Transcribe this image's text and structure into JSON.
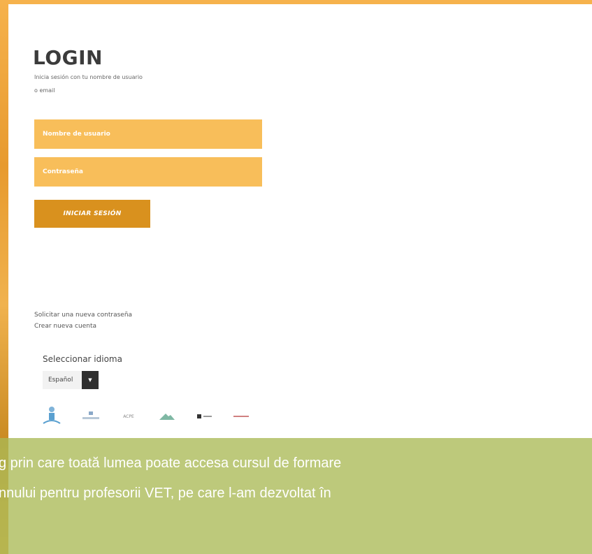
{
  "login": {
    "title": "LOGIN",
    "subtitle": "Inicia sesión con tu nombre de usuario o email",
    "username_placeholder": "Nombre de usuario",
    "password_placeholder": "Contraseña",
    "submit_label": "INICIAR SESIÓN"
  },
  "links": {
    "reset_password": "Solicitar una nueva contraseña",
    "create_account": "Crear nueva cuenta"
  },
  "language": {
    "label": "Seleccionar idioma",
    "selected": "Español"
  },
  "partners": {
    "logo3_text": "ACPE"
  },
  "caption": {
    "line1": "g prin care toată lumea poate accesa cursul de formare",
    "line2": "nnului pentru profesorii VET, pe care l-am dezvoltat în"
  },
  "colors": {
    "accent": "#f6b24c",
    "field": "#f8be5a",
    "button": "#d9911e",
    "caption_bg": "#aaba56"
  }
}
